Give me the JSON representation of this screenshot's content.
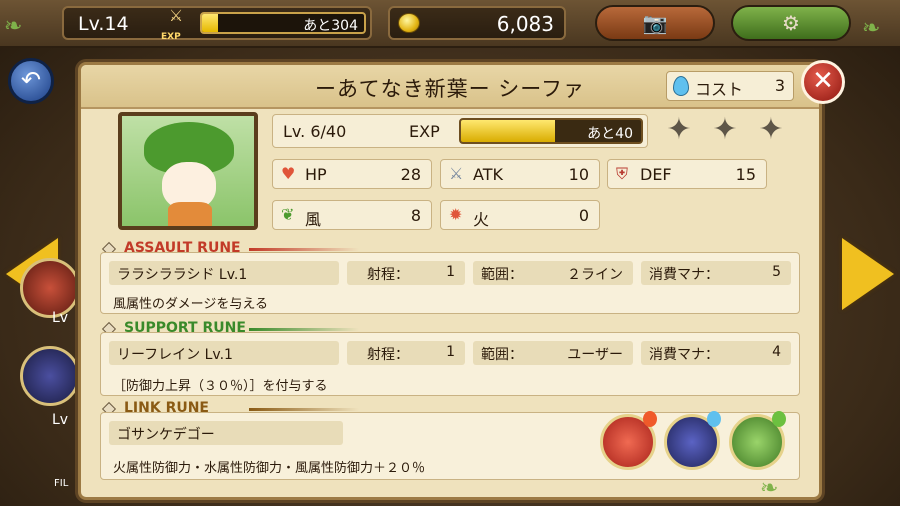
{
  "topbar": {
    "level": "Lv.14",
    "exp_label": "EXP",
    "exp_remaining": "あと304",
    "exp_fill_fraction": 0.1,
    "gold": "6,083"
  },
  "panel": {
    "title": "ーあてなき新葉ー シーファ",
    "cost_label": "コスト",
    "cost_value": "3"
  },
  "character": {
    "level": "Lv. 6/40",
    "exp_label": "EXP",
    "exp_remaining": "あと40",
    "exp_fill_fraction": 0.52,
    "stats": {
      "hp_label": "HP",
      "hp": "28",
      "atk_label": "ATK",
      "atk": "10",
      "def_label": "DEF",
      "def": "15",
      "wind_label": "風",
      "wind": "8",
      "fire_label": "火",
      "fire": "0"
    },
    "stars_filled": 0,
    "stars_total": 3
  },
  "assault_rune": {
    "header": "ASSAULT RUNE",
    "name": "ララシララシド Lv.1",
    "range_label": "射程：",
    "range": "1",
    "area_label": "範囲：",
    "area": "２ライン",
    "mana_label": "消費マナ：",
    "mana": "5",
    "description": "風属性のダメージを与える"
  },
  "support_rune": {
    "header": "SUPPORT RUNE",
    "name": "リーフレイン Lv.1",
    "range_label": "射程：",
    "range": "1",
    "area_label": "範囲：",
    "area": "ユーザー",
    "mana_label": "消費マナ：",
    "mana": "4",
    "description": "［防御力上昇（３０％）］を付与する"
  },
  "link_rune": {
    "header": "LINK RUNE",
    "name": "ゴサンケデゴー",
    "description": "火属性防御力・水属性防御力・風属性防御力＋２０％"
  },
  "side": {
    "lv_label_1": "Lv",
    "lv_label_2": "Lv",
    "filter_label": "FIL"
  },
  "colors": {
    "assault": "#c23a28",
    "support": "#3a8a2a",
    "link": "#8a5a14"
  },
  "icons": {
    "back": "back-arrow-icon",
    "camera": "camera-icon",
    "settings": "gear-icon",
    "close": "close-icon",
    "coin": "gold-coin-icon",
    "cost": "water-drop-icon"
  }
}
